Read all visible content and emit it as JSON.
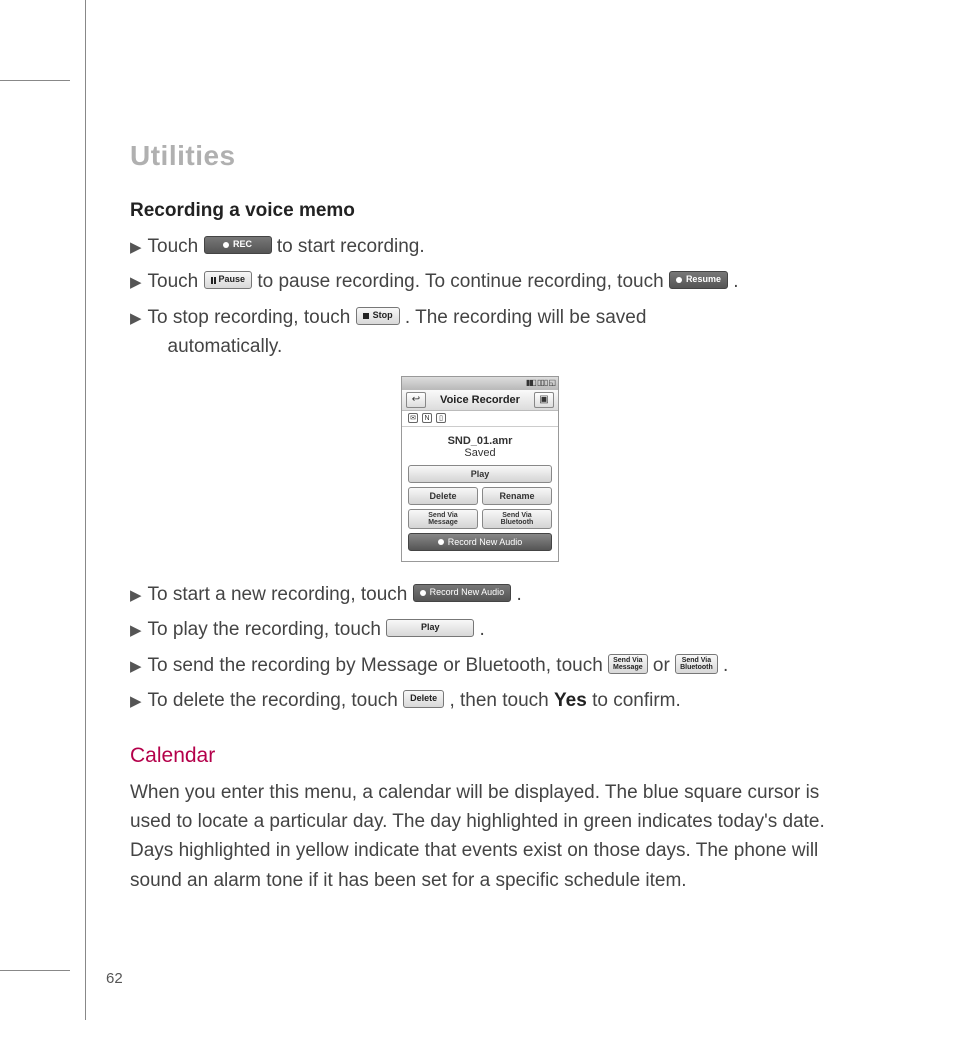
{
  "section_title": "Utilities",
  "subsection_title": "Recording a voice memo",
  "bullets_top": [
    {
      "pre": "Touch ",
      "btn": {
        "style": "dark",
        "icon": "dot",
        "label": "REC",
        "w": "wide60"
      },
      "post": " to start recording."
    },
    {
      "pre": "Touch ",
      "btn": {
        "style": "light",
        "icon": "bars",
        "label": "Pause",
        "w": "wide40"
      },
      "mid": " to pause recording. To continue recording, touch ",
      "btn2": {
        "style": "dark",
        "icon": "dot",
        "label": "Resume",
        "w": "wide50"
      },
      "post": "."
    },
    {
      "pre": "To stop recording, touch ",
      "btn": {
        "style": "light",
        "icon": "sq",
        "label": "Stop",
        "w": "wide40"
      },
      "post": ". The recording will be saved",
      "cont": "automatically."
    }
  ],
  "phone": {
    "title": "Voice Recorder",
    "filename": "SND_01.amr",
    "saved": "Saved",
    "play": "Play",
    "delete": "Delete",
    "rename": "Rename",
    "send_msg_l1": "Send Via",
    "send_msg_l2": "Message",
    "send_bt_l1": "Send Via",
    "send_bt_l2": "Bluetooth",
    "rec_new": "Record New Audio"
  },
  "bullets_bottom": [
    {
      "pre": "To start a new recording, touch ",
      "btn": {
        "style": "dark",
        "icon": "dot",
        "label": "Record New Audio",
        "w": "wide60"
      },
      "post": "."
    },
    {
      "pre": "To play the recording, touch ",
      "btn": {
        "style": "light",
        "icon": "",
        "label": "Play",
        "w": "wide60"
      },
      "post": "."
    },
    {
      "pre": "To send the recording by Message or Bluetooth, touch ",
      "btn": {
        "style": "light-2l",
        "l1": "Send Via",
        "l2": "Message"
      },
      "mid": " or ",
      "btn2": {
        "style": "light-2l",
        "l1": "Send Via",
        "l2": "Bluetooth"
      },
      "post": "."
    },
    {
      "pre": "To delete the recording, touch ",
      "btn": {
        "style": "light",
        "icon": "",
        "label": "Delete",
        "w": "wide40"
      },
      "mid": ", then touch ",
      "strong": "Yes",
      "post": " to confirm."
    }
  ],
  "calendar_title": "Calendar",
  "calendar_body": "When you enter this menu, a calendar will be displayed. The blue square cursor is used to locate a particular day. The day highlighted in green indicates today's date. Days highlighted in yellow indicate that events exist on those days. The phone will sound an alarm tone if it has been set for a specific schedule item.",
  "page_number": "62"
}
